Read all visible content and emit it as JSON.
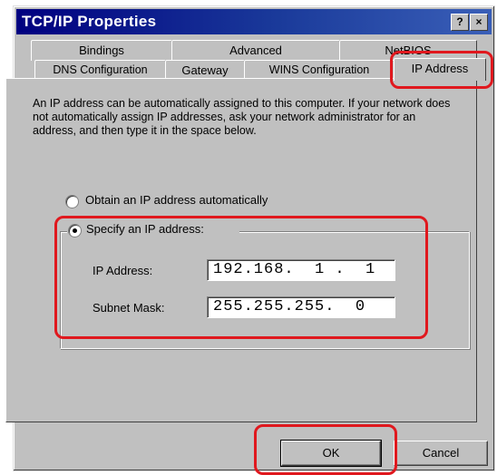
{
  "window": {
    "title": "TCP/IP Properties",
    "help_button": "?",
    "close_button": "×"
  },
  "tabs": {
    "row1": [
      "Bindings",
      "Advanced",
      "NetBIOS"
    ],
    "row2": [
      "DNS Configuration",
      "Gateway",
      "WINS Configuration",
      "IP Address"
    ],
    "active": "IP Address"
  },
  "description": "An IP address can be automatically assigned to this computer. If your network does not automatically assign IP addresses, ask your network administrator for an address, and then type it in the space below.",
  "options": {
    "auto": {
      "label": "Obtain an IP address automatically",
      "selected": false
    },
    "specify": {
      "label": "Specify an IP address:",
      "selected": true
    }
  },
  "fields": {
    "ip_label": "IP Address:",
    "ip_value": "192.168.  1 .  1",
    "mask_label": "Subnet Mask:",
    "mask_value": "255.255.255.  0"
  },
  "buttons": {
    "ok": "OK",
    "cancel": "Cancel"
  },
  "colors": {
    "highlight": "#e0181e",
    "titlebar": "#000080",
    "face": "#c0c0c0"
  }
}
